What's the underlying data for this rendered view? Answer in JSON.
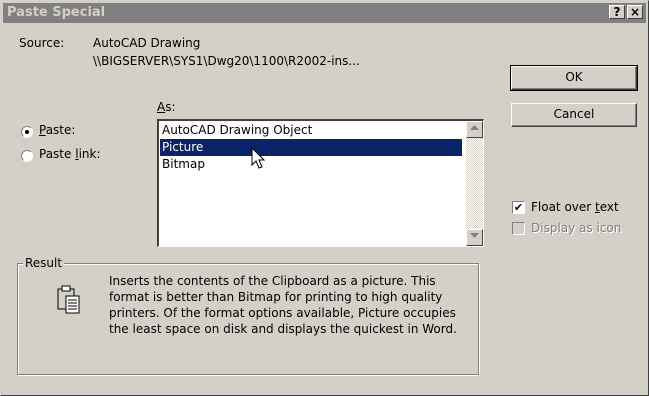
{
  "window": {
    "title": "Paste Special",
    "help_button": "?",
    "close_button": "×"
  },
  "source": {
    "label": "Source:",
    "name": "AutoCAD Drawing",
    "path": "\\\\BIGSERVER\\SYS1\\Dwg20\\1100\\R2002-ins..."
  },
  "as_label": "As:",
  "options": {
    "paste_label": "Paste:",
    "paste_link_label": "Paste link:",
    "selected": "paste"
  },
  "list": {
    "items": [
      "AutoCAD Drawing Object",
      "Picture",
      "Bitmap"
    ],
    "selected_index": 1
  },
  "buttons": {
    "ok": "OK",
    "cancel": "Cancel"
  },
  "checkboxes": {
    "float_over_text": {
      "label": "Float over text",
      "checked": true
    },
    "display_as_icon": {
      "label": "Display as icon",
      "checked": false,
      "disabled": true
    }
  },
  "result": {
    "label": "Result",
    "icon": "clipboard-icon",
    "text": "Inserts the contents of the Clipboard as a picture. This format is better than Bitmap for printing to high quality printers. Of the format options available, Picture occupies the least space on disk and displays the quickest in Word."
  },
  "colors": {
    "title_bar": "#808080",
    "dialog_face": "#d4d0c8",
    "selection": "#0a246a"
  }
}
